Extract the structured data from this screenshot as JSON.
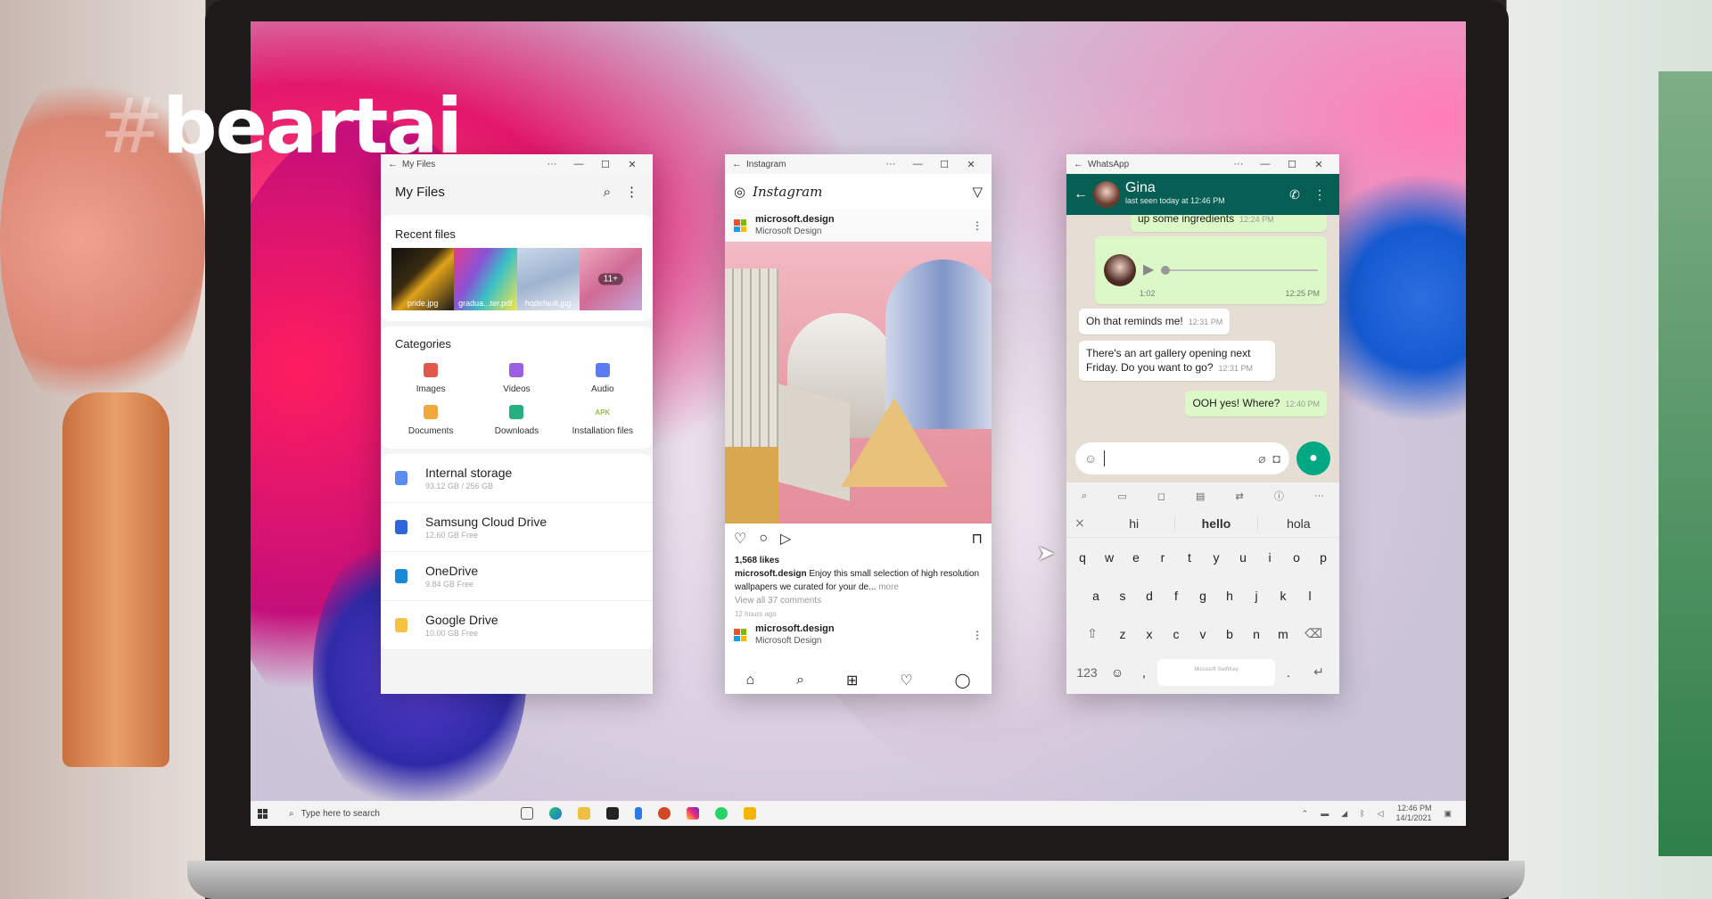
{
  "watermark": {
    "hash": "#",
    "brand": "beartai"
  },
  "files": {
    "window_title": "My Files",
    "header_title": "My Files",
    "recent_title": "Recent files",
    "recent": [
      {
        "name": "pride.jpg"
      },
      {
        "name": "gradua...ter.pdf"
      },
      {
        "name": "hqdefault.jpg"
      },
      {
        "name": "",
        "more": "11+"
      }
    ],
    "categories_title": "Categories",
    "categories": [
      {
        "label": "Images",
        "icon": "image-icon",
        "color": "#e2574c"
      },
      {
        "label": "Videos",
        "icon": "video-icon",
        "color": "#9b5fe0"
      },
      {
        "label": "Audio",
        "icon": "music-note-icon",
        "color": "#5b7cf0"
      },
      {
        "label": "Documents",
        "icon": "document-icon",
        "color": "#f2a93b"
      },
      {
        "label": "Downloads",
        "icon": "download-icon",
        "color": "#27b07d"
      },
      {
        "label": "Installation files",
        "icon": "apk-icon",
        "color": "#8fc43b",
        "glyph": "APK"
      }
    ],
    "storage": [
      {
        "name": "Internal storage",
        "size": "93.12 GB / 256 GB",
        "color": "#5b8def"
      },
      {
        "name": "Samsung Cloud Drive",
        "size": "12.60 GB Free",
        "color": "#2f65d8"
      },
      {
        "name": "OneDrive",
        "size": "9.84 GB Free",
        "color": "#1b8ad6"
      },
      {
        "name": "Google Drive",
        "size": "10.00 GB Free",
        "color": "#f5c242"
      }
    ]
  },
  "instagram": {
    "window_title": "Instagram",
    "logo_text": "Instagram",
    "post_user": "microsoft.design",
    "post_sub": "Microsoft Design",
    "likes": "1,568 likes",
    "caption_user": "microsoft.design",
    "caption": "Enjoy this small selection of high resolution wallpapers we curated for your de...",
    "caption_more": "more",
    "view_comments": "View all 37 comments",
    "time_ago": "12 hours ago",
    "post2_user": "microsoft.design",
    "post2_sub": "Microsoft Design",
    "ms_colors": [
      "#f25022",
      "#7fba00",
      "#00a4ef",
      "#ffb900"
    ]
  },
  "whatsapp": {
    "window_title": "WhatsApp",
    "contact": "Gina",
    "last_seen": "last seen today at 12:46 PM",
    "cut_msg": "up some ingredients",
    "cut_time": "12:24 PM",
    "voice_duration": "1:02",
    "voice_time": "12:25 PM",
    "messages": [
      {
        "dir": "in",
        "text": "Oh that reminds me!",
        "time": "12:31 PM"
      },
      {
        "dir": "in",
        "text": "There's an art gallery opening next Friday. Do you want to go?",
        "time": "12:31 PM"
      },
      {
        "dir": "out",
        "text": "OOH yes! Where?",
        "time": "12:40 PM"
      }
    ],
    "suggestions": [
      "hi",
      "hello",
      "hola"
    ],
    "kb_row1": [
      "q",
      "w",
      "e",
      "r",
      "t",
      "y",
      "u",
      "i",
      "o",
      "p"
    ],
    "kb_row2": [
      "a",
      "s",
      "d",
      "f",
      "g",
      "h",
      "j",
      "k",
      "l"
    ],
    "kb_row3": [
      "z",
      "x",
      "c",
      "v",
      "b",
      "n",
      "m"
    ],
    "kb_num": "123",
    "space_label": "Microsoft SwiftKey",
    "accent": "#075e54",
    "mic_color": "#00a884"
  },
  "taskbar": {
    "search_placeholder": "Type here to search",
    "time": "12:46 PM",
    "date": "14/1/2021",
    "icons": [
      "task-view-icon",
      "edge-icon",
      "file-explorer-icon",
      "store-icon",
      "phone-icon",
      "powerpoint-icon",
      "instagram-icon",
      "whatsapp-icon",
      "myfiles-icon"
    ]
  }
}
